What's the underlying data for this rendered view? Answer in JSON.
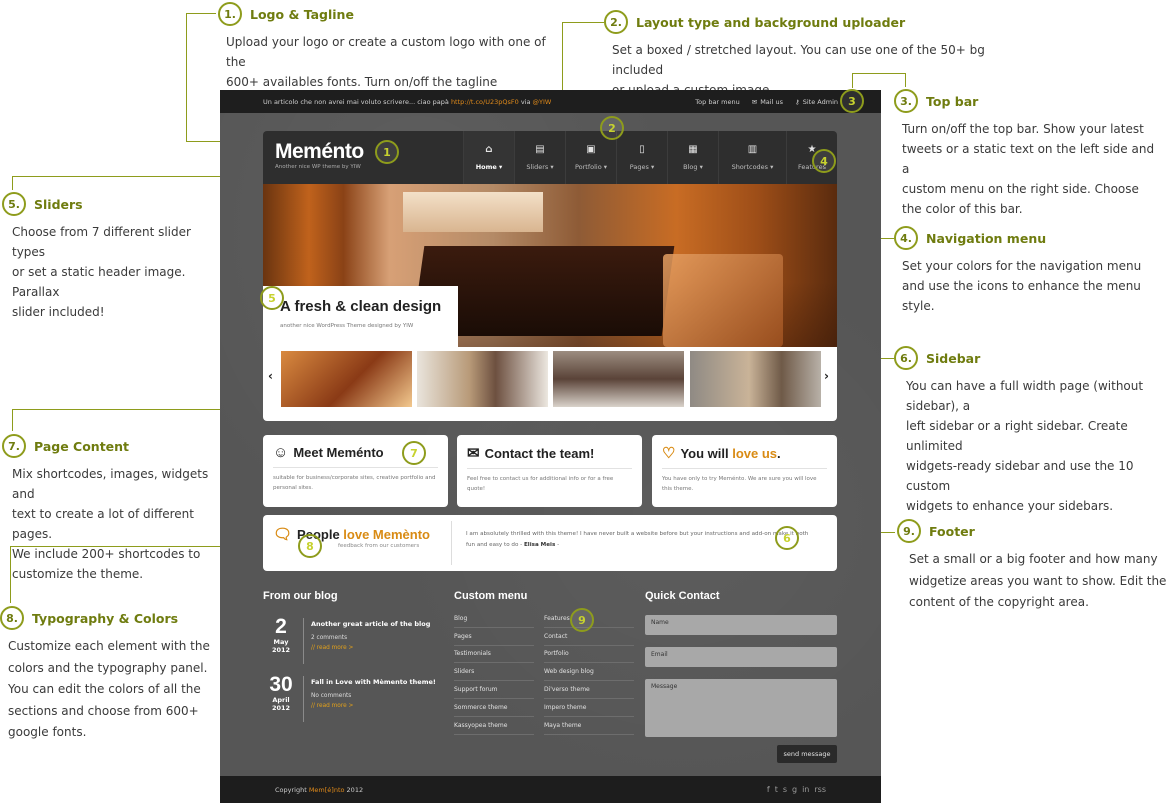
{
  "annotations": [
    {
      "num": "1.",
      "title": "Logo & Tagline",
      "lines": [
        "Upload your logo or create a custom logo with one of the",
        "600+ availables fonts. Turn on/off the tagline"
      ]
    },
    {
      "num": "2.",
      "title": "Layout type and background uploader",
      "lines": [
        "Set a boxed / stretched layout. You can use one of the 50+ bg included",
        "or upload a custom image."
      ]
    },
    {
      "num": "3.",
      "title": "Top bar",
      "lines": [
        "Turn on/off the top bar. Show your latest",
        "tweets or a static text on the left side and a",
        "custom menu on the right side. Choose",
        "the color of this bar."
      ]
    },
    {
      "num": "4.",
      "title": "Navigation menu",
      "lines": [
        "Set your colors for the navigation menu",
        "and use the icons to enhance the menu",
        "style."
      ]
    },
    {
      "num": "5.",
      "title": "Sliders",
      "lines": [
        "Choose from 7 different slider types",
        "or set a static header image. Parallax",
        "slider included!"
      ]
    },
    {
      "num": "6.",
      "title": "Sidebar",
      "lines": [
        "You can have a full width page (without sidebar), a",
        "left sidebar or a right sidebar. Create unlimited",
        "widgets-ready sidebar and use the 10 custom",
        "widgets to enhance your sidebars."
      ]
    },
    {
      "num": "7.",
      "title": "Page Content",
      "lines": [
        "Mix shortcodes, images, widgets and",
        "text to create a lot of different pages.",
        "We include 200+ shortcodes to",
        "customize the theme."
      ]
    },
    {
      "num": "8.",
      "title": "Typography & Colors",
      "lines": [
        "Customize each element with the",
        "colors and the typography panel.",
        "You can edit the colors of all the",
        "sections and choose from 600+",
        "google fonts."
      ]
    },
    {
      "num": "9.",
      "title": "Footer",
      "lines": [
        "Set a small or a big footer and how many",
        "widgetize areas you want to show. Edit the",
        "content of the copyright area."
      ]
    }
  ],
  "markers": [
    "1",
    "2",
    "3",
    "4",
    "5",
    "6",
    "7",
    "8",
    "9"
  ],
  "topbar": {
    "tweet_text": "Un articolo che non avrei mai voluto scrivere... ciao papà",
    "tweet_link": "http://t.co/U23pQsF0",
    "tweet_via": "via",
    "tweet_user": "@YIW",
    "menu_label": "Top bar menu",
    "mail_label": "Mail us",
    "admin_label": "Site Admin"
  },
  "header": {
    "logo": "Meménto",
    "tagline": "Another nice WP theme by YIW"
  },
  "nav": [
    {
      "label": "Home",
      "icon": "⌂",
      "active": true
    },
    {
      "label": "Sliders",
      "icon": "▤"
    },
    {
      "label": "Portfolio",
      "icon": "▣"
    },
    {
      "label": "Pages",
      "icon": "▯"
    },
    {
      "label": "Blog",
      "icon": "▦"
    },
    {
      "label": "Shortcodes",
      "icon": "▥"
    },
    {
      "label": "Features",
      "icon": "★"
    }
  ],
  "slider": {
    "caption_title": "A fresh & clean design",
    "caption_sub": "another nice WordPress Theme designed by YIW",
    "prev": "‹",
    "next": "›"
  },
  "boxes": [
    {
      "icon": "☺",
      "title": "Meet Meménto",
      "text": "suitable for business/corporate sites, creative portfolio and personal sites."
    },
    {
      "icon": "✉",
      "title": "Contact the team!",
      "text": "Feel free to contact us for additional info or for a free quote!"
    },
    {
      "icon": "♡",
      "title_a": "You will ",
      "title_b": "love us",
      "title_c": ".",
      "text": "You have only to try Meménto. We are sure you will love this theme."
    }
  ],
  "testimonial": {
    "title_a": "People ",
    "title_b": "love Memènto",
    "sub": "feedback from our customers",
    "quote": "I am absolutely thrilled with this theme! I have never built a website before but your instructions and add-on make it both fun and easy to do -",
    "author": "Elisa Meis",
    "author_tail": " -"
  },
  "footer": {
    "blog_head": "From our blog",
    "posts": [
      {
        "day": "2",
        "month": "May",
        "year": "2012",
        "title": "Another great article of the blog",
        "comments": "2 comments",
        "more": "// read more >"
      },
      {
        "day": "30",
        "month": "April",
        "year": "2012",
        "title": "Fall in Love with Mèmento theme!",
        "comments": "No comments",
        "more": "// read more >"
      }
    ],
    "menu_head": "Custom menu",
    "menu_left": [
      "Blog",
      "Pages",
      "Testimonials",
      "Sliders",
      "Support forum",
      "Sommerce theme",
      "Kassyopea theme"
    ],
    "menu_right": [
      "Features",
      "Contact",
      "Portfolio",
      "Web design blog",
      "Di'verso theme",
      "Impero theme",
      "Maya theme"
    ],
    "contact_head": "Quick Contact",
    "name_placeholder": "Name",
    "email_placeholder": "Email",
    "message_placeholder": "Message",
    "send_label": "send message"
  },
  "bottombar": {
    "copy_a": "Copyright ",
    "copy_brand": "Mem[é]nto",
    "copy_b": " 2012",
    "social": [
      "f",
      "t",
      "s",
      "g",
      "in",
      "rss"
    ]
  },
  "colors": {
    "accent": "#8e9c1c",
    "accent_text": "#6f7c0f",
    "highlight": "#d98b14"
  }
}
